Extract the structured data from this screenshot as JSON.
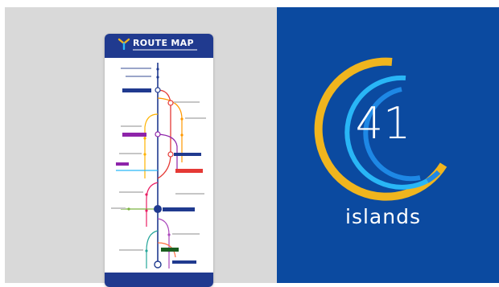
{
  "poster": {
    "title": "ROUTE MAP"
  },
  "stat": {
    "number": "41",
    "caption": "islands"
  },
  "colors": {
    "left_background": "#d9d9d9",
    "right_background": "#0b4aa0",
    "poster_header": "#203a8f",
    "ring_gold": "#f0b51e",
    "ring_light_blue": "#29b6f6",
    "ring_blue": "#1e88e5"
  }
}
